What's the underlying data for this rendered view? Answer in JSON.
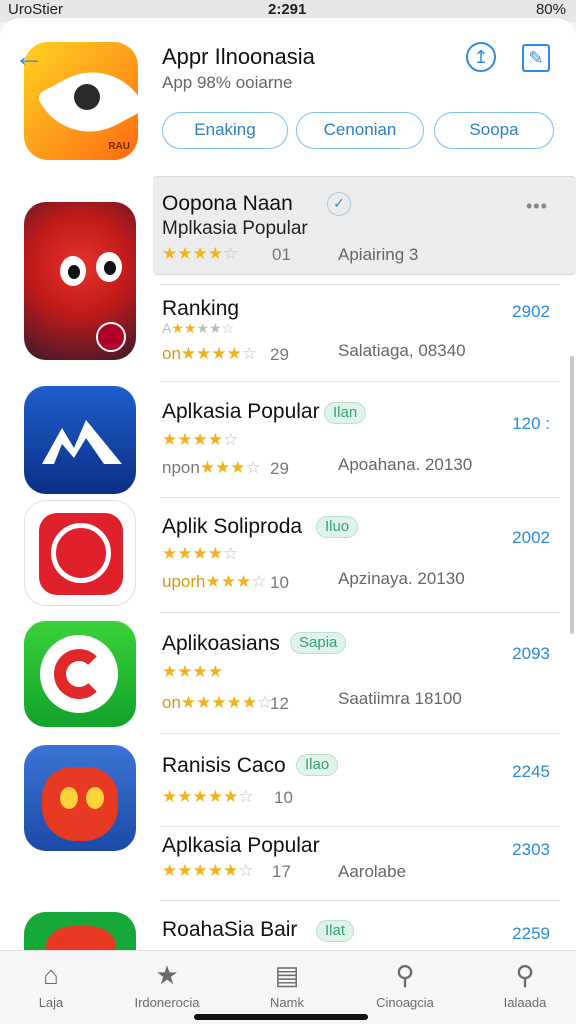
{
  "status": {
    "carrier": "UroStier",
    "time": "2:291",
    "battery": "80%"
  },
  "header": {
    "title": "Appr Ilnoonasia",
    "subtitle": "App 98% ooiarne",
    "pills": [
      "Enaking",
      "Cenonian",
      "Soopa"
    ]
  },
  "apps": [
    {
      "name": "Oopona  Naan",
      "sub": "Mplkasia Popular",
      "stars": "★★★★☆",
      "pre": "",
      "count": "01",
      "meta": "Apiairing  3",
      "price": ""
    },
    {
      "name": "Ranking",
      "sub": "",
      "stars": "★★★★☆",
      "pre": "on",
      "count": "29",
      "meta": "Salatiaga, 08340",
      "price": "2902"
    },
    {
      "name": "Aplkasia Popular",
      "badge": "Ilan",
      "stars": "★★★★☆",
      "pre": "",
      "count": "",
      "pre2": "npon",
      "count2": "29",
      "meta": "Apoahana. 20130",
      "price": "120 :"
    },
    {
      "name": "Aplik Soliproda",
      "badge": "Iluo",
      "stars": "★★★★☆",
      "pre2": "uporh",
      "count2": "10",
      "meta": "Apzinaya. 20130",
      "price": "2002"
    },
    {
      "name": "Aplikoasians",
      "badge": "Sapia",
      "stars": "★★★★",
      "pre2": "on",
      "count2": "12",
      "meta": "Saatiimra  18100",
      "price": "2093"
    },
    {
      "name": "Ranisis Caco",
      "badge": "Ilao",
      "stars": "★★★★☆",
      "count": "10",
      "meta": "",
      "price": "2245"
    },
    {
      "name": "Aplkasia Popular",
      "stars": "★★★★☆",
      "count": "17",
      "meta": "Aarolabe",
      "price": "2303"
    },
    {
      "name": "RoahaSia Bair",
      "badge": "Ilat",
      "price": "2259"
    }
  ],
  "tabs": [
    {
      "label": "Laja",
      "icon": "home-icon"
    },
    {
      "label": "Irdonerocia",
      "icon": "star-icon"
    },
    {
      "label": "Namk",
      "icon": "trash-icon"
    },
    {
      "label": "Cinoagcia",
      "icon": "search-icon"
    },
    {
      "label": "Ialaada",
      "icon": "search-icon"
    }
  ],
  "colors": {
    "accent": "#2f8be0",
    "star": "#f2b21b",
    "badge": "#36a079"
  }
}
